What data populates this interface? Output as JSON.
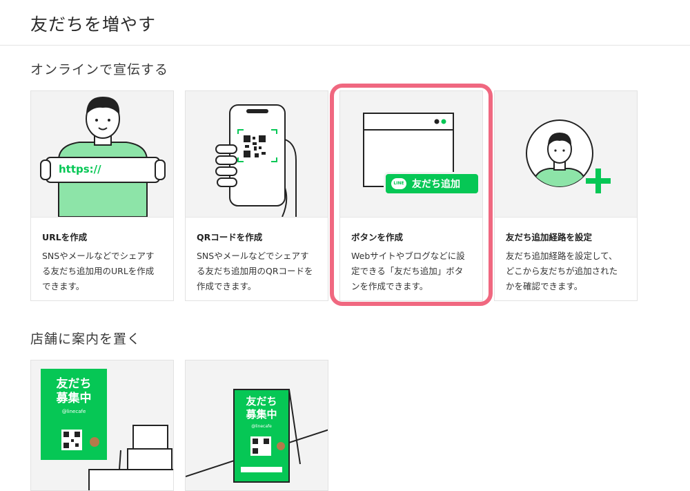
{
  "page": {
    "title": "友だちを増やす"
  },
  "sections": {
    "online": {
      "title": "オンラインで宣伝する"
    },
    "store": {
      "title": "店舗に案内を置く"
    }
  },
  "cards": [
    {
      "illus_text": "https://",
      "title": "URLを作成",
      "desc": "SNSやメールなどでシェアする友だち追加用のURLを作成できます。"
    },
    {
      "illus_text": "",
      "title": "QRコードを作成",
      "desc": "SNSやメールなどでシェアする友だち追加用のQRコードを作成できます。"
    },
    {
      "illus_text": "友だち追加",
      "illus_badge": "LINE",
      "title": "ボタンを作成",
      "desc": "Webサイトやブログなどに設定できる「友だち追加」ボタンを作成できます。"
    },
    {
      "illus_text": "",
      "title": "友だち追加経路を設定",
      "desc": "友だち追加経路を設定して、どこから友だちが追加されたかを確認できます。"
    }
  ],
  "store_cards": [
    {
      "poster_title": "友だち\n募集中",
      "poster_handle": "@linecafe"
    },
    {
      "poster_title": "友だち\n募集中",
      "poster_handle": "@linecafe"
    }
  ],
  "colors": {
    "line_green": "#06c755",
    "person_green": "#8de4a8",
    "highlight": "#f06880"
  }
}
